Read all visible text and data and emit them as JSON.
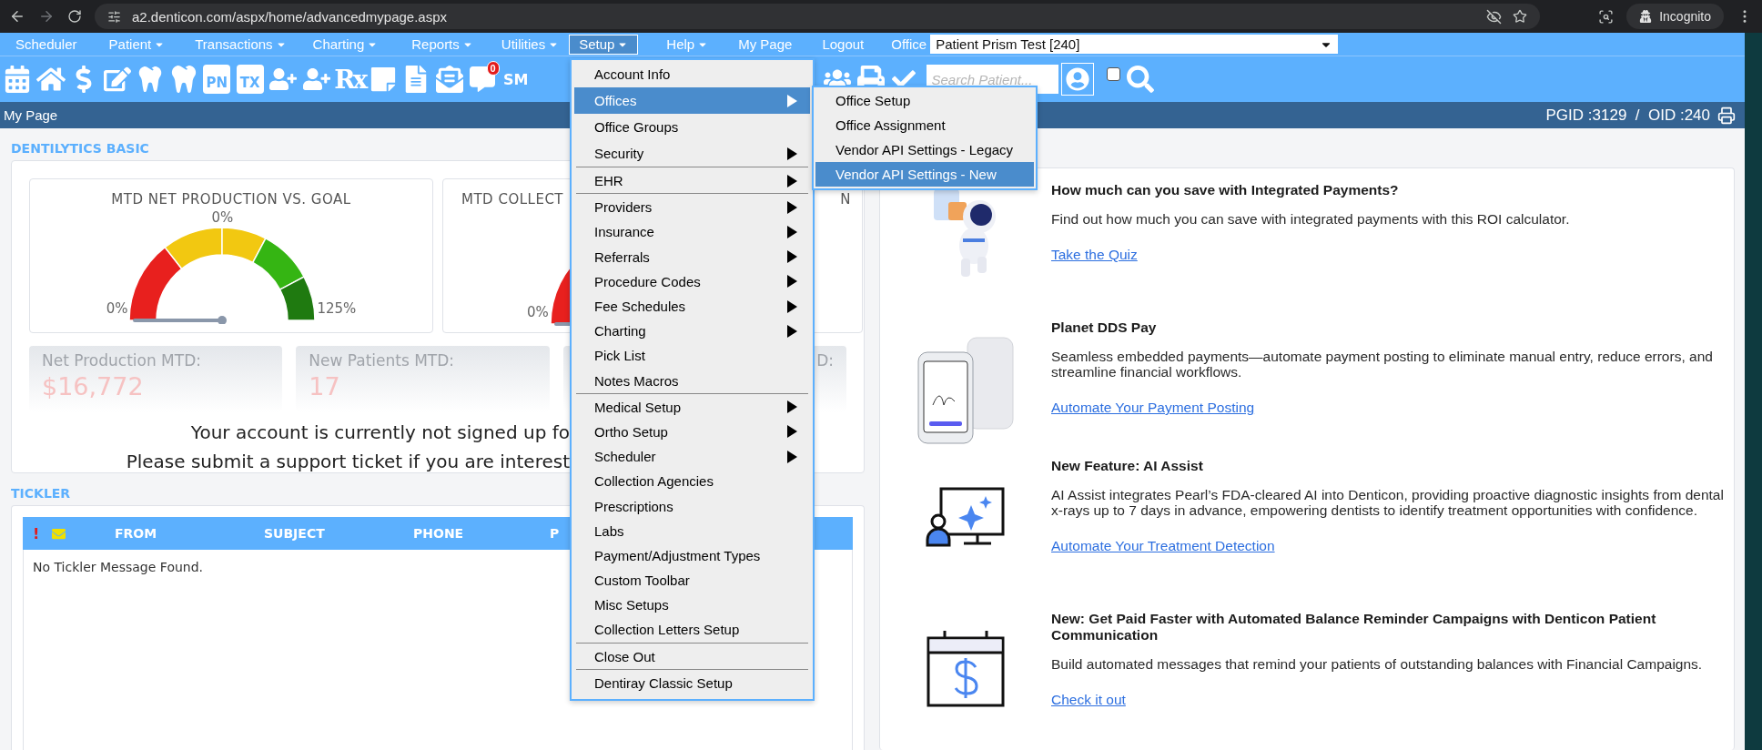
{
  "browser": {
    "url": "a2.denticon.com/aspx/home/advancedmypage.aspx",
    "profile": "Incognito"
  },
  "nav": {
    "items": [
      {
        "label": "Scheduler",
        "dropdown": false,
        "selected": false
      },
      {
        "label": "Patient",
        "dropdown": true,
        "selected": false
      },
      {
        "label": "Transactions",
        "dropdown": true,
        "selected": false
      },
      {
        "label": "Charting",
        "dropdown": true,
        "selected": false
      },
      {
        "label": "Reports",
        "dropdown": true,
        "selected": false
      },
      {
        "label": "Utilities",
        "dropdown": true,
        "selected": false
      },
      {
        "label": "Setup",
        "dropdown": true,
        "selected": true
      },
      {
        "label": "Help",
        "dropdown": true,
        "selected": false
      },
      {
        "label": "My Page",
        "dropdown": false,
        "selected": false
      },
      {
        "label": "Logout",
        "dropdown": false,
        "selected": false
      }
    ],
    "office_label": "Office",
    "office_value": "Patient Prism Test [240]"
  },
  "toolbar": {
    "pn_label": "PN",
    "tx_label": "TX",
    "rx_label": "Rx",
    "message_badge": "0",
    "sm_label": "SM",
    "search": {
      "placeholder": "Search Patient..."
    },
    "group_checkbox": {
      "checked": false
    }
  },
  "page_header": {
    "title": "My Page",
    "ids": "PGID :3129  /  OID :240"
  },
  "dentilytics": {
    "heading": "DENTILYTICS BASIC",
    "gauges": [
      {
        "title": "MTD NET PRODUCTION VS. GOAL",
        "value": "0%",
        "min_label": "0%",
        "max_label": "125%"
      },
      {
        "title": "MTD COLLECT",
        "title_tail": "N",
        "min_label": "0%"
      }
    ],
    "stats": [
      {
        "kind": "full",
        "label": "Net Production MTD:",
        "value": "$16,772"
      },
      {
        "kind": "full",
        "label": "New Patients MTD:",
        "value": "17"
      },
      {
        "kind": "cut",
        "label": "D:"
      }
    ],
    "message": [
      "Your account is currently not signed up fo",
      "Please submit a support ticket if you are interest"
    ]
  },
  "tickler": {
    "heading": "TICKLER",
    "alert_mark": "!",
    "columns": [
      "FROM",
      "SUBJECT",
      "PHONE",
      "P"
    ],
    "empty_text": "No Tickler Message Found."
  },
  "promos": [
    {
      "title": "How much can you save with Integrated Payments?",
      "body": "Find out how much you can save with integrated payments with this ROI calculator.",
      "link": "Take the Quiz"
    },
    {
      "title": "Planet DDS Pay",
      "body": "Seamless embedded payments—automate payment posting to eliminate manual entry, reduce errors, and streamline financial workflows.",
      "link": "Automate Your Payment Posting"
    },
    {
      "title": "New Feature: AI Assist",
      "body": "AI Assist integrates Pearl’s FDA-cleared AI into Denticon, providing proactive diagnostic insights from dental x-rays up to 7 days in advance, empowering dentists to identify treatment opportunities with confidence.",
      "link": "Automate Your Treatment Detection"
    },
    {
      "title": "New: Get Paid Faster with Automated Balance Reminder Campaigns with Denticon Patient Communication",
      "body": "Build automated messages that remind your patients of outstanding balances with Financial Campaigns.",
      "link": "Check it out"
    }
  ],
  "setup_menu": {
    "groups": [
      [
        {
          "label": "Account Info",
          "submenu": false,
          "selected": false
        },
        {
          "label": "Offices",
          "submenu": true,
          "selected": true
        },
        {
          "label": "Office Groups",
          "submenu": false,
          "selected": false
        },
        {
          "label": "Security",
          "submenu": true,
          "selected": false
        }
      ],
      [
        {
          "label": "EHR",
          "submenu": true,
          "selected": false
        }
      ],
      [
        {
          "label": "Providers",
          "submenu": true,
          "selected": false
        },
        {
          "label": "Insurance",
          "submenu": true,
          "selected": false
        },
        {
          "label": "Referrals",
          "submenu": true,
          "selected": false
        },
        {
          "label": "Procedure Codes",
          "submenu": true,
          "selected": false
        },
        {
          "label": "Fee Schedules",
          "submenu": true,
          "selected": false
        },
        {
          "label": "Charting",
          "submenu": true,
          "selected": false
        },
        {
          "label": "Pick List",
          "submenu": false,
          "selected": false
        },
        {
          "label": "Notes Macros",
          "submenu": false,
          "selected": false
        }
      ],
      [
        {
          "label": "Medical Setup",
          "submenu": true,
          "selected": false
        },
        {
          "label": "Ortho Setup",
          "submenu": true,
          "selected": false
        },
        {
          "label": "Scheduler",
          "submenu": true,
          "selected": false
        },
        {
          "label": "Collection Agencies",
          "submenu": false,
          "selected": false
        },
        {
          "label": "Prescriptions",
          "submenu": false,
          "selected": false
        },
        {
          "label": "Labs",
          "submenu": false,
          "selected": false
        },
        {
          "label": "Payment/Adjustment Types",
          "submenu": false,
          "selected": false
        },
        {
          "label": "Custom Toolbar",
          "submenu": false,
          "selected": false
        },
        {
          "label": "Misc Setups",
          "submenu": false,
          "selected": false
        },
        {
          "label": "Collection Letters Setup",
          "submenu": false,
          "selected": false
        }
      ],
      [
        {
          "label": "Close Out",
          "submenu": false,
          "selected": false
        }
      ],
      [
        {
          "label": "Dentiray Classic Setup",
          "submenu": false,
          "selected": false
        }
      ]
    ],
    "submenu": [
      {
        "label": "Office Setup",
        "selected": false
      },
      {
        "label": "Office Assignment",
        "selected": false
      },
      {
        "label": "Vendor API Settings - Legacy",
        "selected": false
      },
      {
        "label": "Vendor API Settings - New",
        "selected": true
      }
    ]
  }
}
